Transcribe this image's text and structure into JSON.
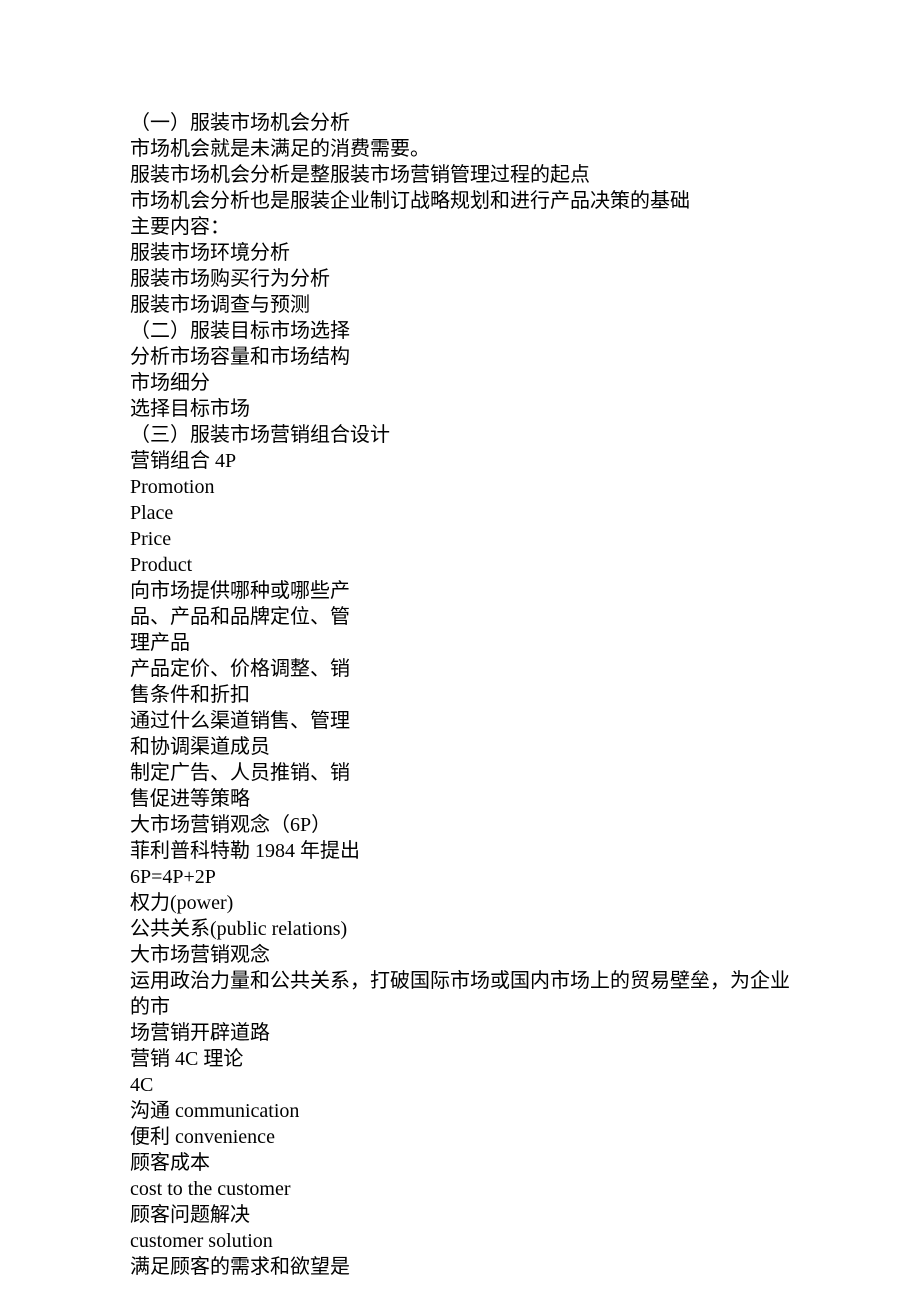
{
  "lines": [
    "（一）服装市场机会分析",
    "市场机会就是未满足的消费需要。",
    "服装市场机会分析是整服装市场营销管理过程的起点",
    "市场机会分析也是服装企业制订战略规划和进行产品决策的基础",
    "主要内容：",
    "服装市场环境分析",
    "服装市场购买行为分析",
    "服装市场调查与预测",
    "（二）服装目标市场选择",
    "分析市场容量和市场结构",
    "市场细分",
    "选择目标市场",
    "（三）服装市场营销组合设计",
    "营销组合 4P",
    "Promotion",
    "Place",
    "Price",
    "Product",
    "向市场提供哪种或哪些产",
    "品、产品和品牌定位、管",
    "理产品",
    "产品定价、价格调整、销",
    "售条件和折扣",
    "通过什么渠道销售、管理",
    "和协调渠道成员",
    "制定广告、人员推销、销",
    "售促进等策略",
    "大市场营销观念（6P）",
    "菲利普科特勒 1984 年提出",
    "6P=4P+2P",
    "权力(power)",
    "公共关系(public relations)",
    "大市场营销观念",
    "运用政治力量和公共关系，打破国际市场或国内市场上的贸易壁垒，为企业的市",
    "场营销开辟道路",
    "营销 4C 理论",
    "4C",
    "沟通 communication",
    "便利 convenience",
    "顾客成本",
    "cost to the customer",
    "顾客问题解决",
    "customer solution",
    "满足顾客的需求和欲望是"
  ]
}
